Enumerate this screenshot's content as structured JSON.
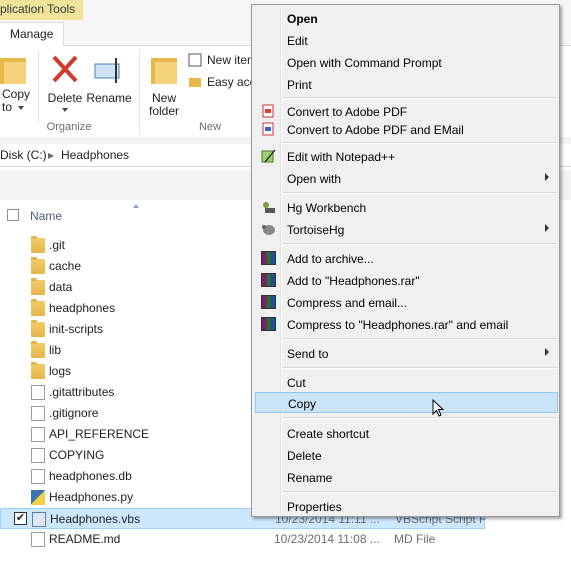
{
  "ribbon": {
    "app_tools": "plication Tools",
    "manage_tab": "Manage",
    "copy_label": "Copy",
    "copy_sub": "to",
    "delete_label": "Delete",
    "rename_label": "Rename",
    "new_folder_line1": "New",
    "new_folder_line2": "folder",
    "new_item": "New item",
    "easy_access": "Easy acce",
    "group_organize": "Organize",
    "group_new": "New"
  },
  "address": {
    "root": "Disk (C:)",
    "current": "Headphones"
  },
  "list": {
    "col_name": "Name",
    "rows": [
      {
        "name": ".git",
        "type": "folder"
      },
      {
        "name": "cache",
        "type": "folder"
      },
      {
        "name": "data",
        "type": "folder"
      },
      {
        "name": "headphones",
        "type": "folder"
      },
      {
        "name": "init-scripts",
        "type": "folder"
      },
      {
        "name": "lib",
        "type": "folder"
      },
      {
        "name": "logs",
        "type": "folder"
      },
      {
        "name": ".gitattributes",
        "type": "file"
      },
      {
        "name": ".gitignore",
        "type": "file"
      },
      {
        "name": "API_REFERENCE",
        "type": "file"
      },
      {
        "name": "COPYING",
        "type": "file"
      },
      {
        "name": "headphones.db",
        "type": "file"
      },
      {
        "name": "Headphones.py",
        "type": "python"
      },
      {
        "name": "Headphones.vbs",
        "type": "vbs",
        "date": "10/23/2014 11:11 ...",
        "kind": "VBScript Script F"
      },
      {
        "name": "README.md",
        "type": "file",
        "date": "10/23/2014 11:08 ...",
        "kind": "MD File"
      }
    ]
  },
  "menu": {
    "open": "Open",
    "edit": "Edit",
    "open_cmd": "Open with Command Prompt",
    "print": "Print",
    "convert_pdf": "Convert to Adobe PDF",
    "convert_pdf_email": "Convert to Adobe PDF and EMail",
    "edit_npp": "Edit with Notepad++",
    "open_with": "Open with",
    "hg_workbench": "Hg Workbench",
    "tortoisehg": "TortoiseHg",
    "add_archive": "Add to archive...",
    "add_rar": "Add to \"Headphones.rar\"",
    "compress_email": "Compress and email...",
    "compress_rar_email": "Compress to \"Headphones.rar\" and email",
    "send_to": "Send to",
    "cut": "Cut",
    "copy": "Copy",
    "create_shortcut": "Create shortcut",
    "delete": "Delete",
    "rename": "Rename",
    "properties": "Properties"
  },
  "colors": {
    "selection": "#cce8ff",
    "menu_highlight": "#cce4f7",
    "app_tools": "#f0e39a"
  }
}
